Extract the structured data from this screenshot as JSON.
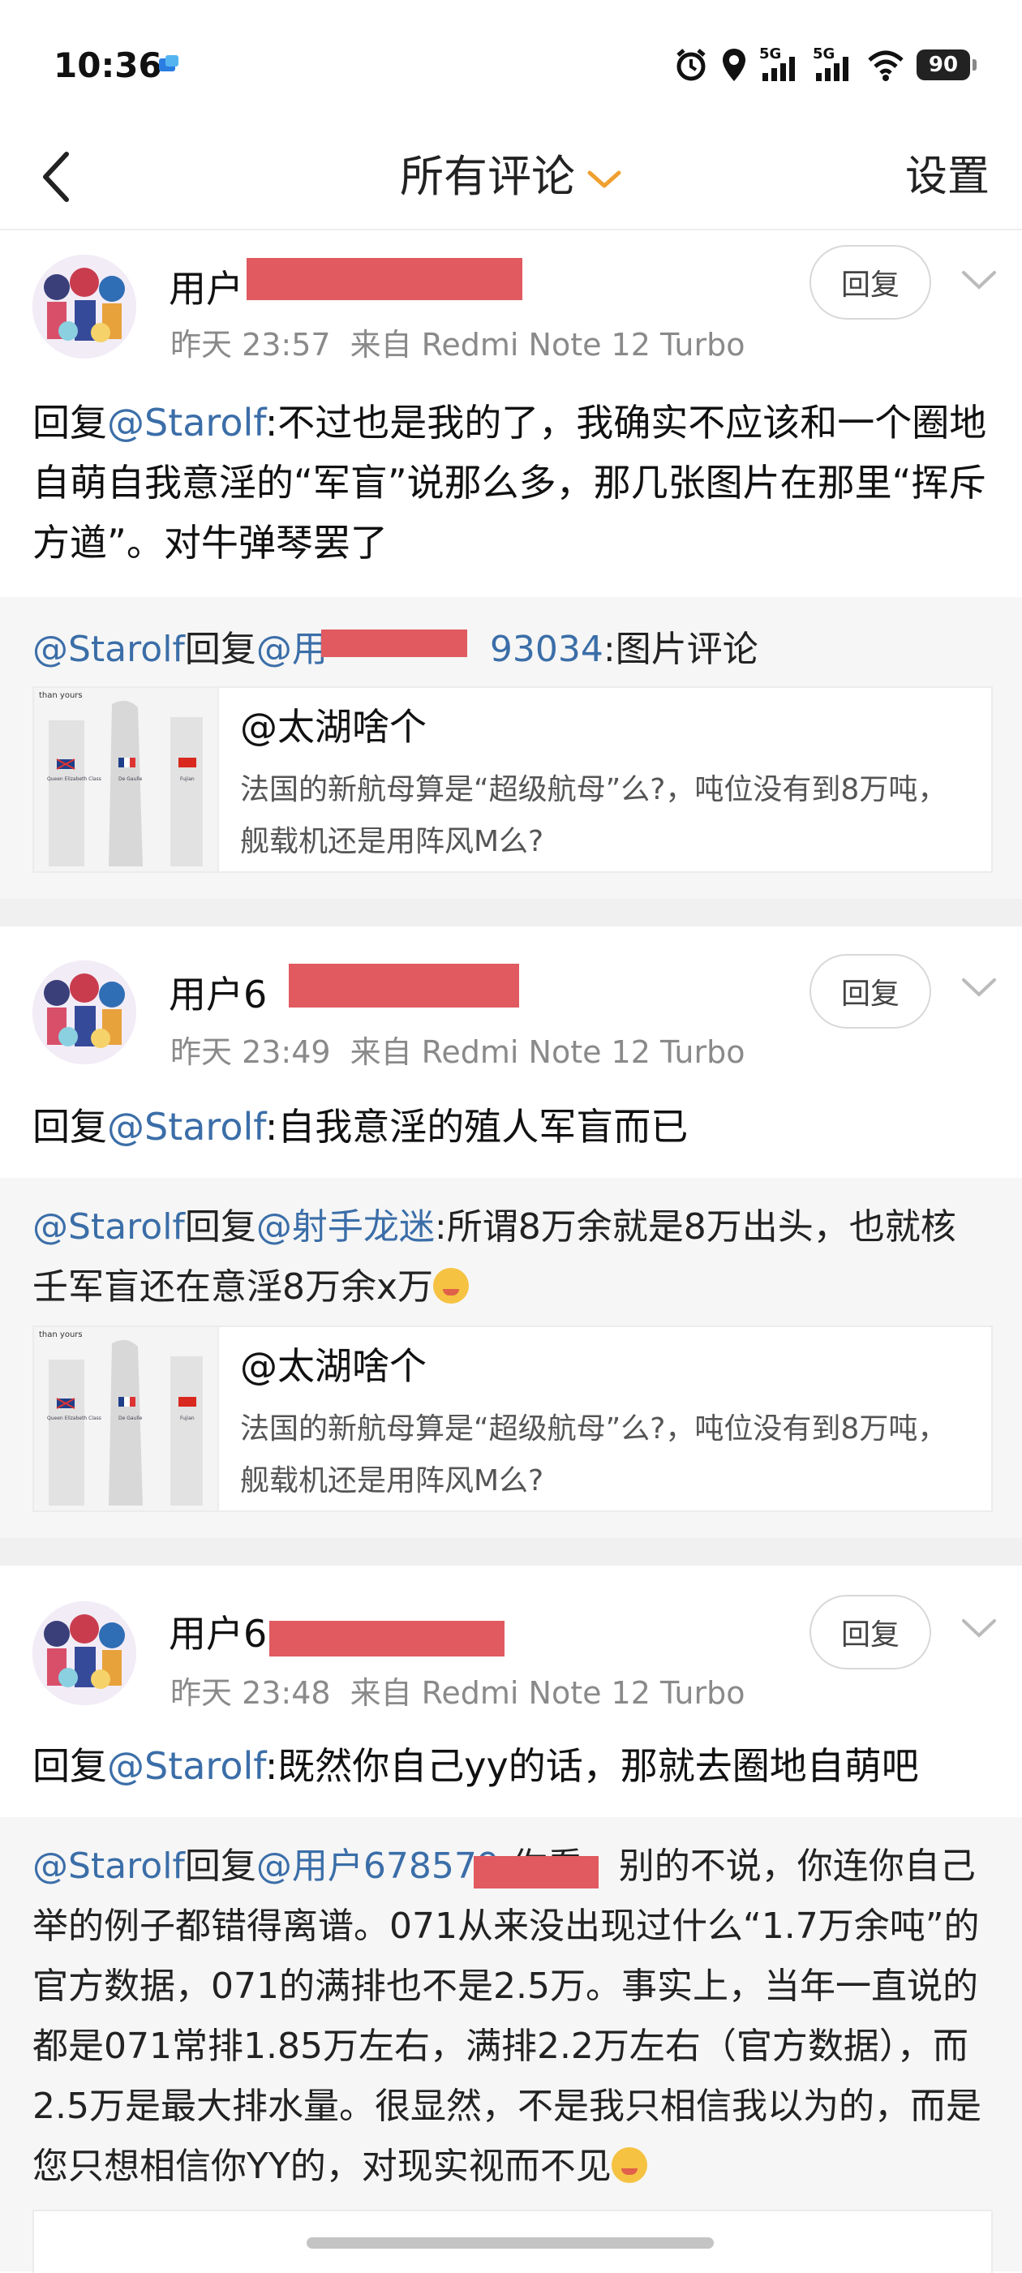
{
  "status_bar": {
    "time": "10:36",
    "battery": "90",
    "network_1": "5G",
    "network_2": "5G"
  },
  "nav": {
    "title": "所有评论",
    "settings_label": "设置"
  },
  "comments": [
    {
      "username": "用户",
      "timestamp": "昨天 23:57",
      "source": "来自 Redmi Note 12 Turbo",
      "reply_label": "回复",
      "body_prefix": "回复",
      "body_mention": "@Starolf",
      "body_text": ":不过也是我的了，我确实不应该和一个圈地自萌自我意淫的“军盲”说那么多，那几张图片在那里“挥斥方遒”。对牛弹琴罢了",
      "quote": {
        "from": "@Starolf",
        "reply_word": "回复",
        "to": "@用",
        "to_suffix": "93034",
        "text": ":图片评论",
        "card_author": "@太湖啥个",
        "card_text": "法国的新航母算是“超级航母”么?，吨位没有到8万吨，舰载机还是用阵风M么?"
      }
    },
    {
      "username": "用户6",
      "timestamp": "昨天 23:49",
      "source": "来自 Redmi Note 12 Turbo",
      "reply_label": "回复",
      "body_prefix": "回复",
      "body_mention": "@Starolf",
      "body_text": ":自我意淫的殖人军盲而已",
      "quote": {
        "from": "@Starolf",
        "reply_word": "回复",
        "to": "@射手龙迷",
        "text": ":所谓8万余就是8万出头，也就核壬军盲还在意淫8万余x万",
        "card_author": "@太湖啥个",
        "card_text": "法国的新航母算是“超级航母”么?，吨位没有到8万吨，舰载机还是用阵风M么?"
      }
    },
    {
      "username": "用户6",
      "timestamp": "昨天 23:48",
      "source": "来自 Redmi Note 12 Turbo",
      "reply_label": "回复",
      "body_prefix": "回复",
      "body_mention": "@Starolf",
      "body_text": ":既然你自己yy的话，那就去圈地自萌吧",
      "quote": {
        "from": "@Starolf",
        "reply_word": "回复",
        "to": "@用户678579",
        "text": ":你看，别的不说，你连你自己举的例子都错得离谱。071从来没出现过什么“1.7万余吨”的官方数据，071的满排也不是2.5万。事实上，当年一直说的都是071常排1.85万左右，满排2.2万左右（官方数据），而2.5万是最大排水量。很显然，不是我只相信我以为的，而是您只想相信你YY的，对现实视而不见"
      }
    }
  ],
  "thumb": {
    "caption": "than yours",
    "flags": [
      "UK",
      "FR",
      "CN"
    ],
    "ship_labels": [
      "Queen Elizabeth Class",
      "De Gaulle",
      "Fujian"
    ]
  }
}
